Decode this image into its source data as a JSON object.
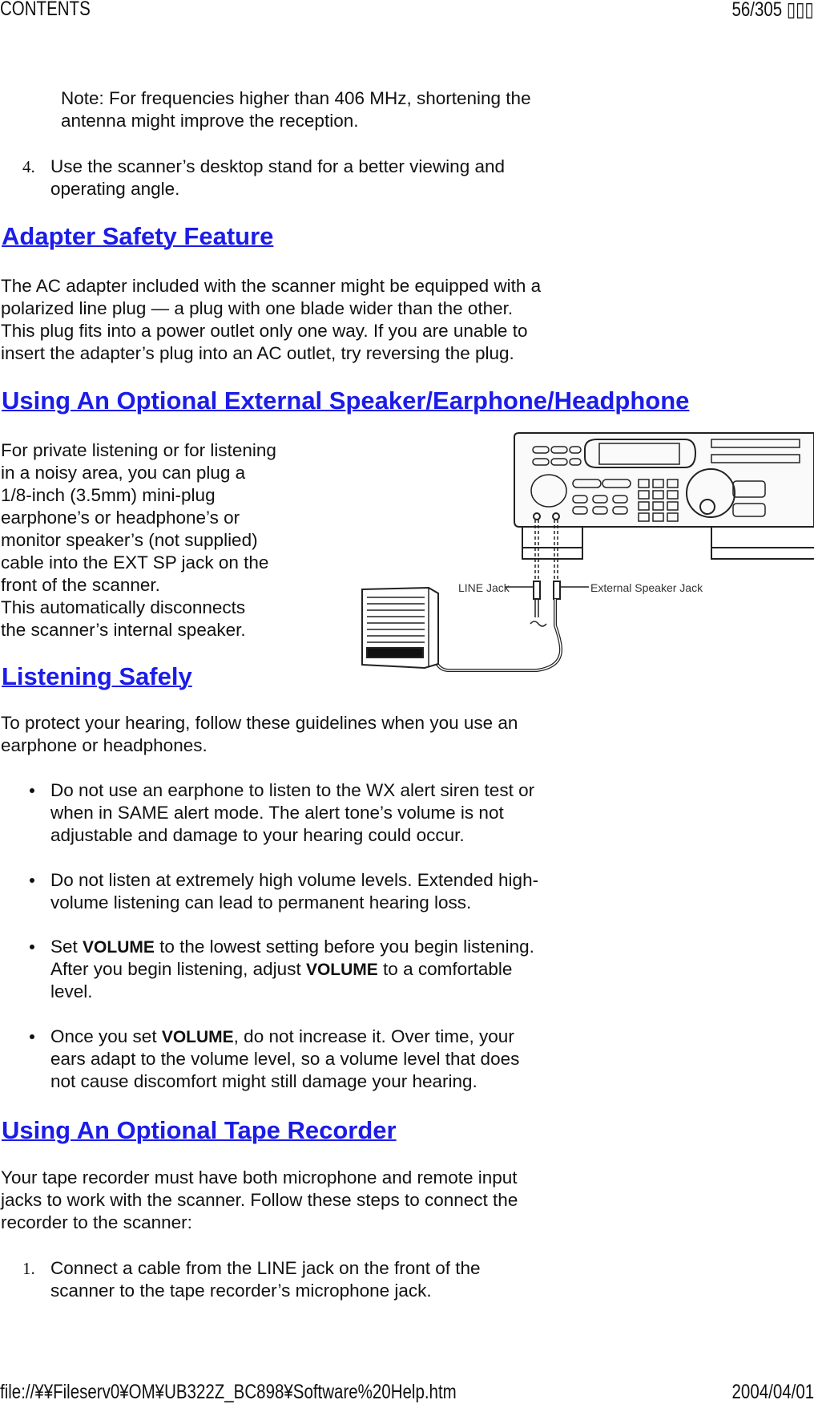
{
  "header": {
    "left": "CONTENTS",
    "page": "56/305",
    "page_suffix": "▯▯▯"
  },
  "footer": {
    "path": "file://¥¥Fileserv0¥OM¥UB322Z_BC898¥Software%20Help.htm",
    "date": "2004/04/01"
  },
  "note": [
    "Note: For frequencies higher than 406 MHz, shortening the",
    "antenna might improve the reception."
  ],
  "step4": {
    "number": "4.",
    "lines": [
      "Use the scanner’s desktop stand for a better viewing and",
      "operating angle."
    ]
  },
  "adapter": {
    "heading": "Adapter Safety Feature",
    "lines": [
      "The AC adapter included with the scanner might be equipped with a",
      "polarized line plug — a plug with one blade wider than the other.",
      "This plug fits into a power outlet only one way. If you are unable to",
      "insert the adapter’s plug into an AC outlet, try reversing the plug."
    ]
  },
  "speaker": {
    "heading": "Using An Optional External Speaker/Earphone/Headphone",
    "lines": [
      "For private listening or for listening",
      "in a noisy area, you can plug a",
      "1/8-inch (3.5mm) mini-plug",
      "earphone’s or headphone’s or",
      "monitor speaker’s (not supplied)",
      "cable into the EXT SP jack on the",
      "front of the scanner.",
      "This automatically disconnects",
      "the scanner’s internal speaker."
    ],
    "figure": {
      "line_jack_label": "LINE Jack",
      "ext_jack_label": "External Speaker Jack"
    }
  },
  "listening": {
    "heading": "Listening Safely",
    "lines": [
      "To protect your hearing, follow these guidelines when you use an",
      "earphone or headphones."
    ],
    "bullets": [
      [
        [
          {
            "t": "Do not use an earphone to listen to the WX alert siren test or"
          }
        ],
        [
          {
            "t": "when in SAME alert mode. The alert tone’s volume is not"
          }
        ],
        [
          {
            "t": "adjustable and damage to your hearing could occur."
          }
        ]
      ],
      [
        [
          {
            "t": "Do not listen at extremely high volume levels. Extended high-"
          }
        ],
        [
          {
            "t": "volume listening can lead to permanent hearing loss."
          }
        ]
      ],
      [
        [
          {
            "t": "Set "
          },
          {
            "t": "VOLUME",
            "b": true
          },
          {
            "t": " to the lowest setting before you begin listening."
          }
        ],
        [
          {
            "t": "After you begin listening, adjust "
          },
          {
            "t": "VOLUME",
            "b": true
          },
          {
            "t": " to a comfortable"
          }
        ],
        [
          {
            "t": "level."
          }
        ]
      ],
      [
        [
          {
            "t": "Once you set "
          },
          {
            "t": "VOLUME",
            "b": true
          },
          {
            "t": ", do not increase it. Over time, your"
          }
        ],
        [
          {
            "t": "ears adapt to the volume level, so a volume level that does"
          }
        ],
        [
          {
            "t": "not cause discomfort might still damage your hearing."
          }
        ]
      ]
    ]
  },
  "tape": {
    "heading": "Using An Optional Tape Recorder",
    "lines": [
      "Your tape recorder must have both microphone and remote input",
      "jacks to work with the scanner. Follow these steps to connect the",
      "recorder to the scanner:"
    ],
    "step1": {
      "number": "1.",
      "lines": [
        "Connect a cable from the LINE jack on the front of the",
        "scanner to the tape recorder’s microphone jack."
      ]
    }
  }
}
